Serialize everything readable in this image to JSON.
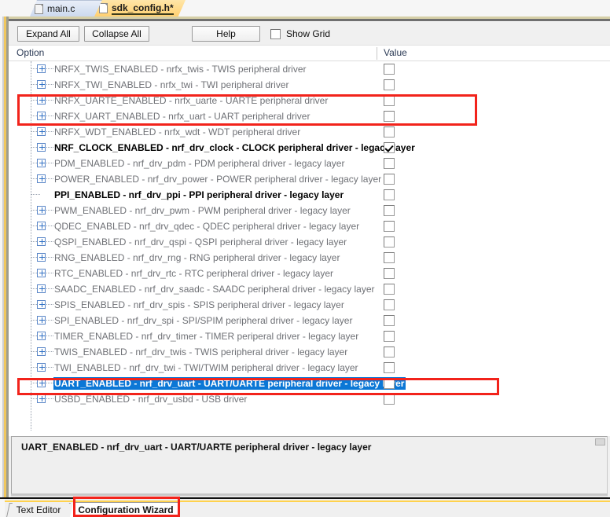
{
  "editor_tabs": [
    {
      "label": "main.c",
      "active": false,
      "icon": "document-icon"
    },
    {
      "label": "sdk_config.h*",
      "active": true,
      "icon": "document-icon"
    }
  ],
  "toolbar": {
    "expand_all_label": "Expand All",
    "collapse_all_label": "Collapse All",
    "help_label": "Help",
    "show_grid_label": "Show Grid",
    "show_grid_checked": false
  },
  "columns": {
    "option_header": "Option",
    "value_header": "Value"
  },
  "colors": {
    "selection_blue": "#0b77d6",
    "annotation_red": "#f2231b",
    "active_tab_yellow": "#ffd98a",
    "disabled_text": "#6f7176",
    "enabled_text": "#000000"
  },
  "tree_rows": [
    {
      "label": "NRFX_TWIS_ENABLED - nrfx_twis - TWIS peripheral driver",
      "expandable": true,
      "checked": false,
      "state": "disabled",
      "selected": false
    },
    {
      "label": "NRFX_TWI_ENABLED - nrfx_twi - TWI peripheral driver",
      "expandable": true,
      "checked": false,
      "state": "disabled",
      "selected": false
    },
    {
      "label": "NRFX_UARTE_ENABLED - nrfx_uarte - UARTE peripheral driver",
      "expandable": true,
      "checked": false,
      "state": "disabled",
      "selected": false
    },
    {
      "label": "NRFX_UART_ENABLED - nrfx_uart - UART peripheral driver",
      "expandable": true,
      "checked": false,
      "state": "disabled",
      "selected": false
    },
    {
      "label": "NRFX_WDT_ENABLED - nrfx_wdt - WDT peripheral driver",
      "expandable": true,
      "checked": false,
      "state": "disabled",
      "selected": false
    },
    {
      "label": "NRF_CLOCK_ENABLED - nrf_drv_clock - CLOCK peripheral driver - legacy layer",
      "expandable": true,
      "checked": true,
      "state": "enabled",
      "selected": false
    },
    {
      "label": "PDM_ENABLED - nrf_drv_pdm - PDM peripheral driver - legacy layer",
      "expandable": true,
      "checked": false,
      "state": "disabled",
      "selected": false
    },
    {
      "label": "POWER_ENABLED - nrf_drv_power - POWER peripheral driver - legacy layer",
      "expandable": true,
      "checked": false,
      "state": "disabled",
      "selected": false
    },
    {
      "label": "PPI_ENABLED  - nrf_drv_ppi - PPI peripheral driver - legacy layer",
      "expandable": false,
      "checked": false,
      "state": "enabled",
      "selected": false
    },
    {
      "label": "PWM_ENABLED - nrf_drv_pwm - PWM peripheral driver - legacy layer",
      "expandable": true,
      "checked": false,
      "state": "disabled",
      "selected": false
    },
    {
      "label": "QDEC_ENABLED - nrf_drv_qdec - QDEC peripheral driver - legacy layer",
      "expandable": true,
      "checked": false,
      "state": "disabled",
      "selected": false
    },
    {
      "label": "QSPI_ENABLED - nrf_drv_qspi - QSPI peripheral driver - legacy layer",
      "expandable": true,
      "checked": false,
      "state": "disabled",
      "selected": false
    },
    {
      "label": "RNG_ENABLED - nrf_drv_rng - RNG peripheral driver - legacy layer",
      "expandable": true,
      "checked": false,
      "state": "disabled",
      "selected": false
    },
    {
      "label": "RTC_ENABLED - nrf_drv_rtc - RTC peripheral driver - legacy layer",
      "expandable": true,
      "checked": false,
      "state": "disabled",
      "selected": false
    },
    {
      "label": "SAADC_ENABLED - nrf_drv_saadc - SAADC peripheral driver - legacy layer",
      "expandable": true,
      "checked": false,
      "state": "disabled",
      "selected": false
    },
    {
      "label": "SPIS_ENABLED - nrf_drv_spis - SPIS peripheral driver - legacy layer",
      "expandable": true,
      "checked": false,
      "state": "disabled",
      "selected": false
    },
    {
      "label": "SPI_ENABLED - nrf_drv_spi - SPI/SPIM peripheral driver - legacy layer",
      "expandable": true,
      "checked": false,
      "state": "disabled",
      "selected": false
    },
    {
      "label": "TIMER_ENABLED - nrf_drv_timer - TIMER periperal driver - legacy layer",
      "expandable": true,
      "checked": false,
      "state": "disabled",
      "selected": false
    },
    {
      "label": "TWIS_ENABLED - nrf_drv_twis - TWIS peripheral driver - legacy layer",
      "expandable": true,
      "checked": false,
      "state": "disabled",
      "selected": false
    },
    {
      "label": "TWI_ENABLED - nrf_drv_twi - TWI/TWIM peripheral driver - legacy layer",
      "expandable": true,
      "checked": false,
      "state": "disabled",
      "selected": false
    },
    {
      "label": "UART_ENABLED - nrf_drv_uart - UART/UARTE peripheral driver - legacy layer",
      "expandable": true,
      "checked": false,
      "state": "disabled",
      "selected": true
    },
    {
      "label": "USBD_ENABLED - nrf_drv_usbd - USB driver",
      "expandable": true,
      "checked": false,
      "state": "disabled",
      "selected": false
    }
  ],
  "description": {
    "text": "UART_ENABLED - nrf_drv_uart - UART/UARTE peripheral driver - legacy layer"
  },
  "view_tabs": [
    {
      "label": "Text Editor",
      "active": false
    },
    {
      "label": "Configuration Wizard",
      "active": true
    }
  ],
  "annotations": [
    {
      "name": "nrfx-uart-rows-highlight"
    },
    {
      "name": "uart-enabled-row-highlight"
    },
    {
      "name": "configuration-wizard-tab-highlight"
    }
  ]
}
